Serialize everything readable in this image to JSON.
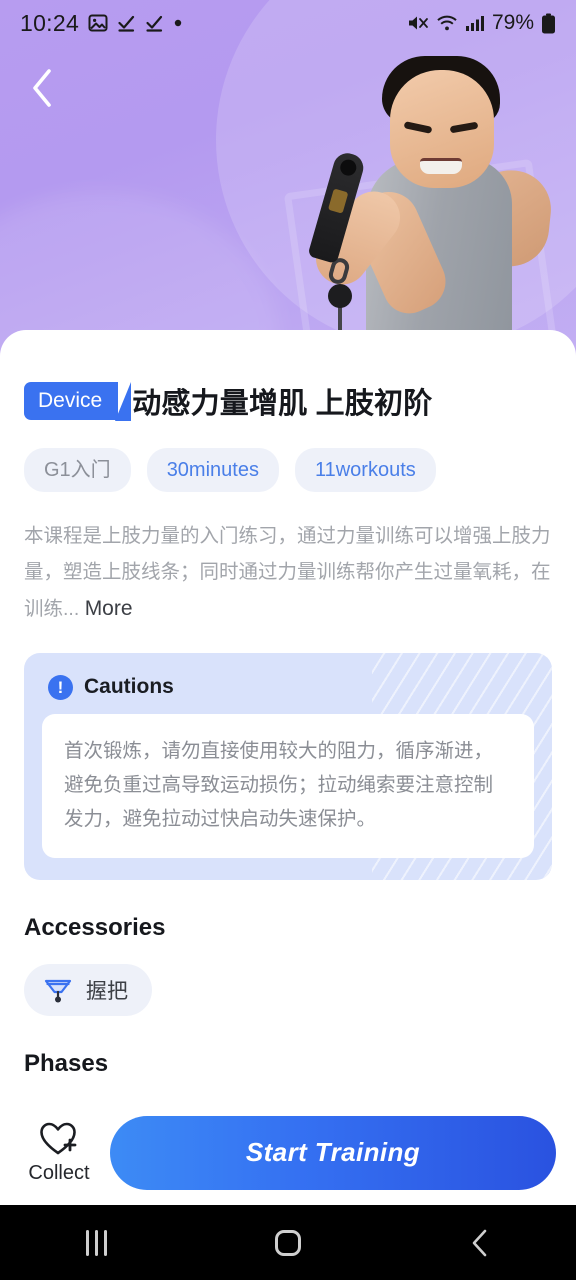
{
  "status_bar": {
    "time": "10:24",
    "left_icons": [
      "image-icon",
      "task-check-icon",
      "task-check-icon",
      "dot-icon"
    ],
    "battery_percent": "79%",
    "right_icons": [
      "mute-icon",
      "wifi-icon",
      "signal-icon",
      "battery-icon"
    ]
  },
  "hero": {
    "back_icon": "back-chevron-icon",
    "image_alt": "athlete-pulling-cable-handle"
  },
  "course": {
    "badge": "Device",
    "title": "动感力量增肌 上肢初阶",
    "tags": [
      {
        "label": "G1入门",
        "style": "gray"
      },
      {
        "label": "30minutes",
        "style": "blue"
      },
      {
        "label": "11workouts",
        "style": "blue"
      }
    ],
    "description": "本课程是上肢力量的入门练习，通过力量训练可以增强上肢力量，塑造上肢线条；同时通过力量训练帮你产生过量氧耗，在训练...",
    "more_label": "More"
  },
  "cautions": {
    "icon": "exclamation-circle-icon",
    "title": "Cautions",
    "text": "首次锻炼，请勿直接使用较大的阻力，循序渐进，避免负重过高导致运动损伤；拉动绳索要注意控制发力，避免拉动过快启动失速保护。"
  },
  "accessories": {
    "title": "Accessories",
    "items": [
      {
        "label": "握把",
        "icon": "grip-handle-icon"
      }
    ]
  },
  "phases": {
    "title": "Phases",
    "items": [
      {
        "alt": "phase-thumbnail-1"
      },
      {
        "alt": "phase-thumbnail-2"
      },
      {
        "alt": "phase-thumbnail-3"
      }
    ]
  },
  "bottom_bar": {
    "collect_label": "Collect",
    "collect_icon": "heart-plus-icon",
    "start_label": "Start Training"
  },
  "nav_bar": {
    "recents_icon": "recents-icon",
    "home_icon": "home-icon",
    "back_icon": "back-chevron-icon"
  },
  "colors": {
    "accent_blue": "#3a72f0",
    "hero_purple": "#b79cf0",
    "tag_bg": "#eef1f9",
    "caution_bg": "#d9e2fb"
  }
}
